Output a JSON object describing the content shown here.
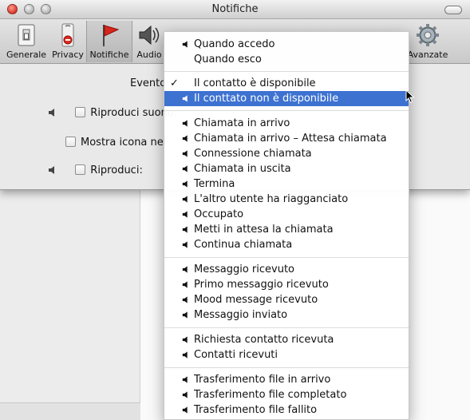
{
  "window": {
    "title": "Notifiche"
  },
  "toolbar": {
    "items": [
      {
        "label": "Generale",
        "icon": "switch-icon"
      },
      {
        "label": "Privacy",
        "icon": "privacy-sign-icon"
      },
      {
        "label": "Notifiche",
        "icon": "flag-icon"
      },
      {
        "label": "Audio",
        "icon": "speaker-icon"
      },
      {
        "label": "Avanzate",
        "icon": "gear-icon"
      }
    ]
  },
  "panel": {
    "evento_label": "Evento",
    "options": [
      {
        "label": "Riproduci suono:",
        "speaker": true
      },
      {
        "label": "Mostra icona nel",
        "speaker": false
      },
      {
        "label": "Riproduci:",
        "speaker": true
      }
    ]
  },
  "menu": {
    "selected_color": "#3d72d1",
    "groups": [
      [
        {
          "label": "Quando accedo",
          "speaker": true
        },
        {
          "label": "Quando esco",
          "speaker": false
        }
      ],
      [
        {
          "label": "Il contatto è disponibile",
          "speaker": false,
          "checked": true
        },
        {
          "label": "Il conttato non è disponibile",
          "speaker": true,
          "highlighted": true
        }
      ],
      [
        {
          "label": "Chiamata in arrivo",
          "speaker": true
        },
        {
          "label": "Chiamata in arrivo – Attesa chiamata",
          "speaker": true
        },
        {
          "label": "Connessione chiamata",
          "speaker": true
        },
        {
          "label": "Chiamata in uscita",
          "speaker": true
        },
        {
          "label": "Termina",
          "speaker": true
        },
        {
          "label": "L'altro utente ha riagganciato",
          "speaker": true
        },
        {
          "label": "Occupato",
          "speaker": true
        },
        {
          "label": "Metti in attesa la chiamata",
          "speaker": true
        },
        {
          "label": "Continua chiamata",
          "speaker": true
        }
      ],
      [
        {
          "label": "Messaggio ricevuto",
          "speaker": true
        },
        {
          "label": "Primo messaggio ricevuto",
          "speaker": true
        },
        {
          "label": "Mood message ricevuto",
          "speaker": true
        },
        {
          "label": "Messaggio inviato",
          "speaker": true
        }
      ],
      [
        {
          "label": "Richiesta contatto ricevuta",
          "speaker": true
        },
        {
          "label": "Contatti ricevuti",
          "speaker": true
        }
      ],
      [
        {
          "label": "Trasferimento file in arrivo",
          "speaker": true
        },
        {
          "label": "Trasferimento file completato",
          "speaker": true
        },
        {
          "label": "Trasferimento file fallito",
          "speaker": true
        }
      ]
    ]
  }
}
